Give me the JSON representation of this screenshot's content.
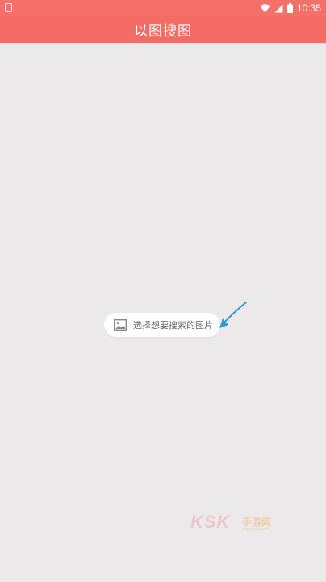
{
  "status_bar": {
    "time": "10:35",
    "icons": [
      "notification-icon",
      "wifi-icon",
      "signal-icon",
      "battery-icon"
    ]
  },
  "app_bar": {
    "title": "以图搜图"
  },
  "main": {
    "pick_image_label": "选择想要搜索的图片",
    "pick_image_icon": "image-icon"
  },
  "watermark": {
    "brand": "KSK",
    "brand_cn": "手游网",
    "url": "www.ksk.com"
  },
  "colors": {
    "accent": "#f36b63",
    "background": "#ebe9ea",
    "arrow": "#2d9ad6"
  }
}
